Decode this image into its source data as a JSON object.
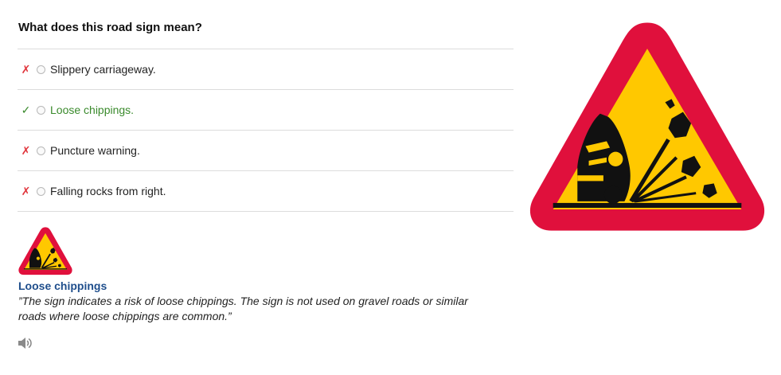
{
  "question": {
    "title": "What does this road sign mean?"
  },
  "options": [
    {
      "label": "Slippery carriageway.",
      "mark": "✗",
      "correct": false
    },
    {
      "label": "Loose chippings.",
      "mark": "✓",
      "correct": true
    },
    {
      "label": "Puncture warning.",
      "mark": "✗",
      "correct": false
    },
    {
      "label": "Falling rocks from right.",
      "mark": "✗",
      "correct": false
    }
  ],
  "explanation": {
    "title": "Loose chippings",
    "text": "”The sign indicates a risk of loose chippings. The sign is not used on gravel roads or similar roads where loose chippings are common.”"
  },
  "colors": {
    "sign_border": "#e0103c",
    "sign_fill": "#ffc800",
    "correct": "#3a8a2c",
    "wrong": "#e0333a",
    "link_title": "#1f4e8c"
  },
  "icons": {
    "sign": "loose-chippings-warning-sign",
    "audio": "speaker-icon"
  }
}
